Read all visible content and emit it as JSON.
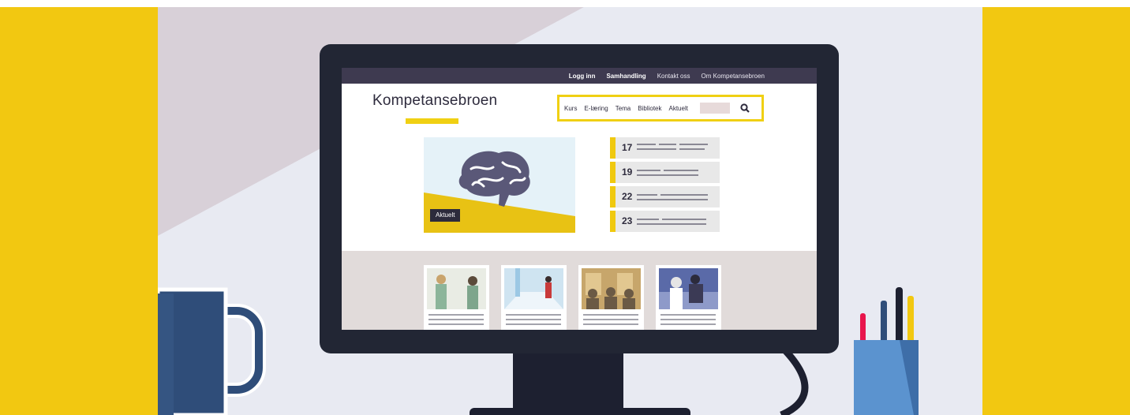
{
  "topnav": {
    "items": [
      "Logg inn",
      "Samhandling",
      "Kontakt oss",
      "Om Kompetansebroen"
    ]
  },
  "site": {
    "logo": "Kompetansebroen"
  },
  "mainnav": {
    "items": [
      "Kurs",
      "E-læring",
      "Tema",
      "Bibliotek",
      "Aktuelt"
    ]
  },
  "hero": {
    "badge": "Aktuelt"
  },
  "events": [
    {
      "day": "17"
    },
    {
      "day": "19"
    },
    {
      "day": "22"
    },
    {
      "day": "23"
    }
  ],
  "icons": {
    "search": "search-icon",
    "brain": "brain-icon",
    "mug": "mug-icon",
    "pen_holder": "pen-holder-icon"
  },
  "colors": {
    "accent_yellow": "#f2c811",
    "monitor": "#222634",
    "topbar": "#3e3a50",
    "mug_blue": "#2f4d79"
  }
}
